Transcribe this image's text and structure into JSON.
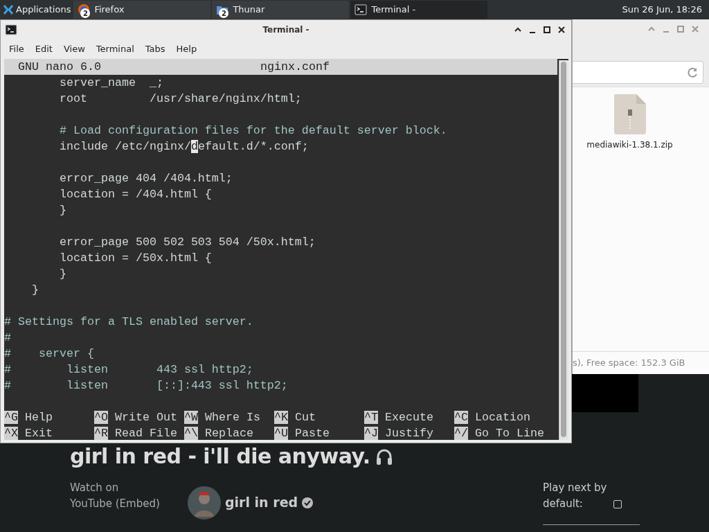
{
  "taskbar": {
    "apps_menu": "Applications",
    "tasks": [
      {
        "label": "Firefox",
        "count": "2",
        "kind": "browser",
        "selected": false
      },
      {
        "label": "Thunar",
        "count": "2",
        "kind": "files",
        "selected": false
      },
      {
        "label": "Terminal -",
        "kind": "terminal",
        "selected": true
      }
    ],
    "clock": "Sun 26 Jun, 18:26"
  },
  "terminal": {
    "title": "Terminal -",
    "menu": [
      "File",
      "Edit",
      "View",
      "Terminal",
      "Tabs",
      "Help"
    ],
    "nano": {
      "version": "GNU nano 6.0",
      "filename": "nginx.conf",
      "lines": [
        {
          "kind": "code",
          "text": "        server_name  _;"
        },
        {
          "kind": "code",
          "text": "        root         /usr/share/nginx/html;"
        },
        {
          "kind": "blank"
        },
        {
          "kind": "comment",
          "text": "        # Load configuration files for the default server block."
        },
        {
          "kind": "code",
          "text": "        include /etc/nginx/",
          "cursor": "d",
          "after": "efault.d/*.conf;"
        },
        {
          "kind": "blank"
        },
        {
          "kind": "code",
          "text": "        error_page 404 /404.html;"
        },
        {
          "kind": "code",
          "text": "        location = /404.html {"
        },
        {
          "kind": "code",
          "text": "        }"
        },
        {
          "kind": "blank"
        },
        {
          "kind": "code",
          "text": "        error_page 500 502 503 504 /50x.html;"
        },
        {
          "kind": "code",
          "text": "        location = /50x.html {"
        },
        {
          "kind": "code",
          "text": "        }"
        },
        {
          "kind": "code",
          "text": "    }"
        },
        {
          "kind": "blank"
        },
        {
          "kind": "comment",
          "text": "# Settings for a TLS enabled server."
        },
        {
          "kind": "comment",
          "text": "#"
        },
        {
          "kind": "comment",
          "text": "#    server {"
        },
        {
          "kind": "comment",
          "text": "#        listen       443 ssl http2;"
        },
        {
          "kind": "comment",
          "text": "#        listen       [::]:443 ssl http2;"
        },
        {
          "kind": "blank"
        }
      ],
      "shortcuts": [
        [
          {
            "key": "^G",
            "label": "Help"
          },
          {
            "key": "^O",
            "label": "Write Out"
          },
          {
            "key": "^W",
            "label": "Where Is"
          },
          {
            "key": "^K",
            "label": "Cut"
          },
          {
            "key": "^T",
            "label": "Execute"
          },
          {
            "key": "^C",
            "label": "Location"
          }
        ],
        [
          {
            "key": "^X",
            "label": "Exit"
          },
          {
            "key": "^R",
            "label": "Read File"
          },
          {
            "key": "^\\",
            "label": "Replace"
          },
          {
            "key": "^U",
            "label": "Paste"
          },
          {
            "key": "^J",
            "label": "Justify"
          },
          {
            "key": "^/",
            "label": "Go To Line"
          }
        ]
      ]
    }
  },
  "file_manager": {
    "files": [
      {
        "name": "mediawiki-1.38.1.zip"
      }
    ],
    "status": "s), Free space: 152.3 GiB"
  },
  "browser_page": {
    "title": "girl in red - i'll die anyway.",
    "watch_on": "Watch on YouTube (Embed)",
    "channel": "girl in red",
    "verified": true,
    "autoplay_label": "Play next by default:",
    "autoplay_checked": false
  }
}
